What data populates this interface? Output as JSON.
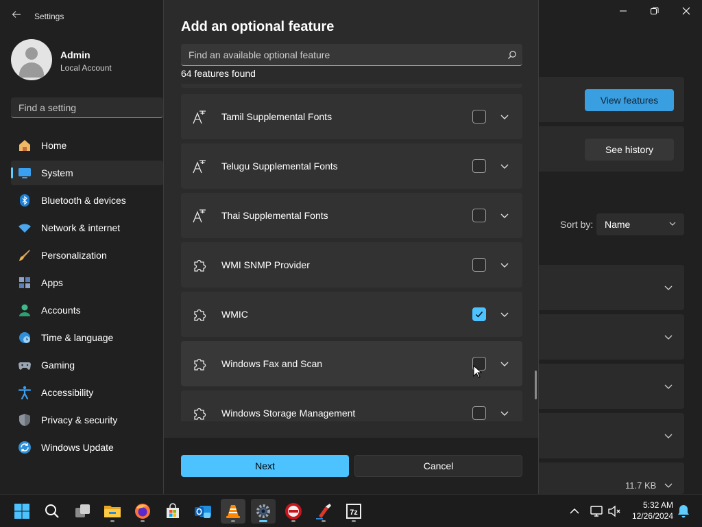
{
  "window": {
    "title": "Settings",
    "controls": [
      "minimize",
      "maximize",
      "close"
    ]
  },
  "profile": {
    "name": "Admin",
    "account_type": "Local Account"
  },
  "search_setting": {
    "placeholder": "Find a setting"
  },
  "sidebar": {
    "items": [
      {
        "label": "Home",
        "icon": "home-icon",
        "active": false
      },
      {
        "label": "System",
        "icon": "system-icon",
        "active": true
      },
      {
        "label": "Bluetooth & devices",
        "icon": "bluetooth-icon",
        "active": false
      },
      {
        "label": "Network & internet",
        "icon": "wifi-icon",
        "active": false
      },
      {
        "label": "Personalization",
        "icon": "brush-icon",
        "active": false
      },
      {
        "label": "Apps",
        "icon": "apps-icon",
        "active": false
      },
      {
        "label": "Accounts",
        "icon": "accounts-icon",
        "active": false
      },
      {
        "label": "Time & language",
        "icon": "globe-icon",
        "active": false
      },
      {
        "label": "Gaming",
        "icon": "gamepad-icon",
        "active": false
      },
      {
        "label": "Accessibility",
        "icon": "accessibility-icon",
        "active": false
      },
      {
        "label": "Privacy & security",
        "icon": "shield-icon",
        "active": false
      },
      {
        "label": "Windows Update",
        "icon": "update-icon",
        "active": false
      }
    ]
  },
  "background_page": {
    "view_features_label": "View features",
    "see_history_label": "See history",
    "sort_label": "Sort by:",
    "sort_value": "Name",
    "size_text": "11.7 KB"
  },
  "dialog": {
    "title": "Add an optional feature",
    "search_placeholder": "Find an available optional feature",
    "found_text": "64 features found",
    "features": [
      {
        "name": "Tamil Supplemental Fonts",
        "icon": "font-icon",
        "checked": false
      },
      {
        "name": "Telugu Supplemental Fonts",
        "icon": "font-icon",
        "checked": false
      },
      {
        "name": "Thai Supplemental Fonts",
        "icon": "font-icon",
        "checked": false
      },
      {
        "name": "WMI SNMP Provider",
        "icon": "puzzle-icon",
        "checked": false
      },
      {
        "name": "WMIC",
        "icon": "puzzle-icon",
        "checked": true
      },
      {
        "name": "Windows Fax and Scan",
        "icon": "puzzle-icon",
        "checked": false
      },
      {
        "name": "Windows Storage Management",
        "icon": "puzzle-icon",
        "checked": false
      }
    ],
    "next_label": "Next",
    "cancel_label": "Cancel"
  },
  "taskbar": {
    "apps": [
      "start-icon",
      "search-icon",
      "task-view-icon",
      "file-explorer-icon",
      "firefox-icon",
      "store-icon",
      "outlook-icon",
      "vlc-icon",
      "settings-icon",
      "rufus-icon",
      "ccleaner-icon",
      "7zip-icon"
    ],
    "time": "5:32 AM",
    "date": "12/26/2024"
  },
  "colors": {
    "accent": "#4cc2ff",
    "background": "#202020",
    "dialog": "#2b2b2b",
    "card": "#323232"
  }
}
